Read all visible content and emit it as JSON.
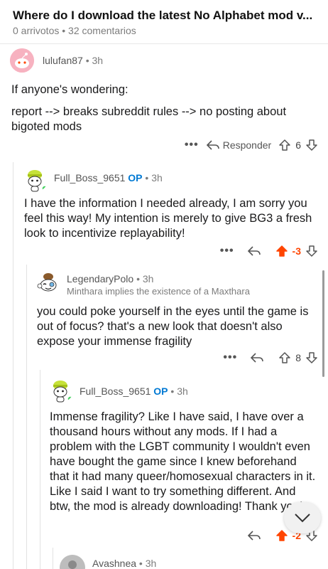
{
  "post": {
    "title": "Where do I download the latest No Alphabet mod v...",
    "meta": "0 arrivotos • 32 comentarios"
  },
  "comments": [
    {
      "username": "lulufan87",
      "time": "3h",
      "body": [
        "If anyone's wondering:",
        "report --> breaks subreddit rules --> no posting about bigoted mods"
      ],
      "reply_label": "Responder",
      "score": "6"
    },
    {
      "username": "Full_Boss_9651",
      "op": "OP",
      "time": "3h",
      "body": [
        "I have the information I needed already, I am sorry you feel this way! My intention is merely to give BG3 a fresh look to incentivize replayability!"
      ],
      "score": "-3"
    },
    {
      "username": "LegendaryPolo",
      "time": "3h",
      "flair": "Minthara implies the existence of a Maxthara",
      "body": [
        "you could poke yourself in the eyes until the game is out of focus? that's a new look that doesn't also expose your immense fragility"
      ],
      "score": "8"
    },
    {
      "username": "Full_Boss_9651",
      "op": "OP",
      "time": "3h",
      "body": [
        "Immense fragility? Like I have said, I have over a thousand hours without any mods. If I had a problem with the LGBT community I wouldn't even have bought the game since I knew beforehand that it had many queer/homosexual characters in it. Like I said I want to try something different. And btw, the mod is already downloading! Thank you!"
      ],
      "score": "-2"
    },
    {
      "username": "Avashnea",
      "time": "3h"
    }
  ],
  "icons": {
    "more": "more-options-icon",
    "reply": "reply-arrow-icon",
    "upvote": "upvote-arrow-icon",
    "downvote": "downvote-arrow-icon",
    "collapse": "chevron-down-icon"
  },
  "colors": {
    "upvoted": "#ff4500",
    "op_badge": "#0079d3",
    "online_dot": "#46d160"
  }
}
